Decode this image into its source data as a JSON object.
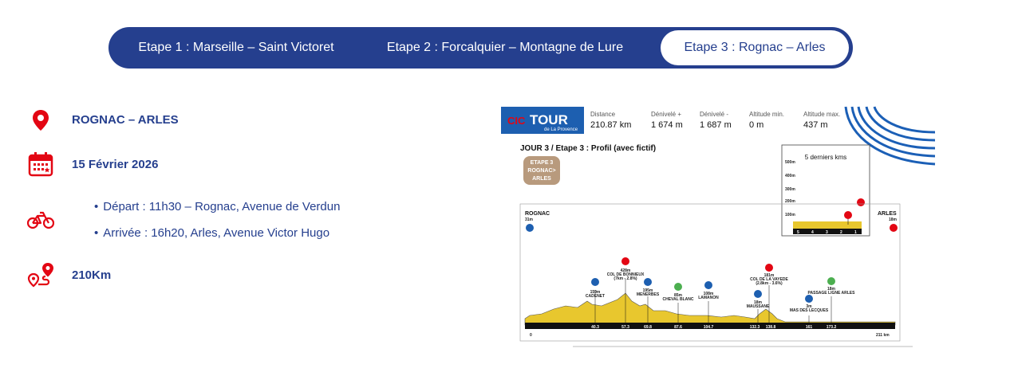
{
  "tabs": [
    {
      "label": "Etape 1 : Marseille – Saint Victoret",
      "active": false
    },
    {
      "label": "Etape 2 : Forcalquier – Montagne de Lure",
      "active": false
    },
    {
      "label": "Etape 3 : Rognac – Arles",
      "active": true
    }
  ],
  "stage": {
    "route": "ROGNAC – ARLES",
    "date": "15 Février 2026",
    "depart": "Départ : 11h30 – Rognac, Avenue de Verdun",
    "arrivee": "Arrivée : 16h20, Arles, Avenue Victor Hugo",
    "distance": "210Km"
  },
  "colors": {
    "brand_blue": "#253f8e",
    "accent_red": "#e30613",
    "profile_yellow": "#e8c72e"
  },
  "profile": {
    "logo_text": "TOUR",
    "logo_cic": "CIC",
    "logo_sub": "de La Provence",
    "stats": [
      {
        "label": "Distance",
        "value": "210.87 km"
      },
      {
        "label": "Dénivelé +",
        "value": "1 674 m"
      },
      {
        "label": "Dénivelé -",
        "value": "1 687 m"
      },
      {
        "label": "Altitude min.",
        "value": "0 m"
      },
      {
        "label": "Altitude max.",
        "value": "437 m"
      }
    ],
    "title": "JOUR 3 / Etape 3 : Profil (avec fictif)",
    "badge": [
      "ETAPE 3",
      "ROGNAC>",
      "ARLES"
    ],
    "inset_title": "5 derniers kms",
    "inset_y": [
      "500m",
      "400m",
      "300m",
      "200m",
      "100m"
    ],
    "inset_x": [
      "5",
      "4",
      "3",
      "2",
      "1"
    ],
    "start": {
      "name": "ROGNAC",
      "alt": "31m"
    },
    "finish": {
      "name": "ARLES",
      "alt": "18m"
    },
    "km_start": "0",
    "km_end": "211 km",
    "points": [
      {
        "name": "CADENET",
        "alt": "159m",
        "km": "40.3"
      },
      {
        "name": "COL DE BONNIEUX",
        "alt": "428m",
        "extra": "(7km - 2.8%)",
        "km": "57.3"
      },
      {
        "name": "MENERBES",
        "alt": "195m",
        "km": "69.8"
      },
      {
        "name": "CHEVAL BLANC",
        "alt": "85m",
        "km": "87.6"
      },
      {
        "name": "LAMANON",
        "alt": "108m",
        "km": "104.7"
      },
      {
        "name": "MAUSSANE",
        "alt": "18m",
        "km": "132.3"
      },
      {
        "name": "COL DE LA VAYEDE",
        "alt": "181m",
        "extra": "(2.8km - 3.6%)",
        "km": "138.8"
      },
      {
        "name": "MAS DES LECQUES",
        "alt": "3m",
        "km": "161"
      },
      {
        "name": "PASSAGE LIGNE ARLES",
        "alt": "18m",
        "km": "173.2"
      }
    ]
  }
}
